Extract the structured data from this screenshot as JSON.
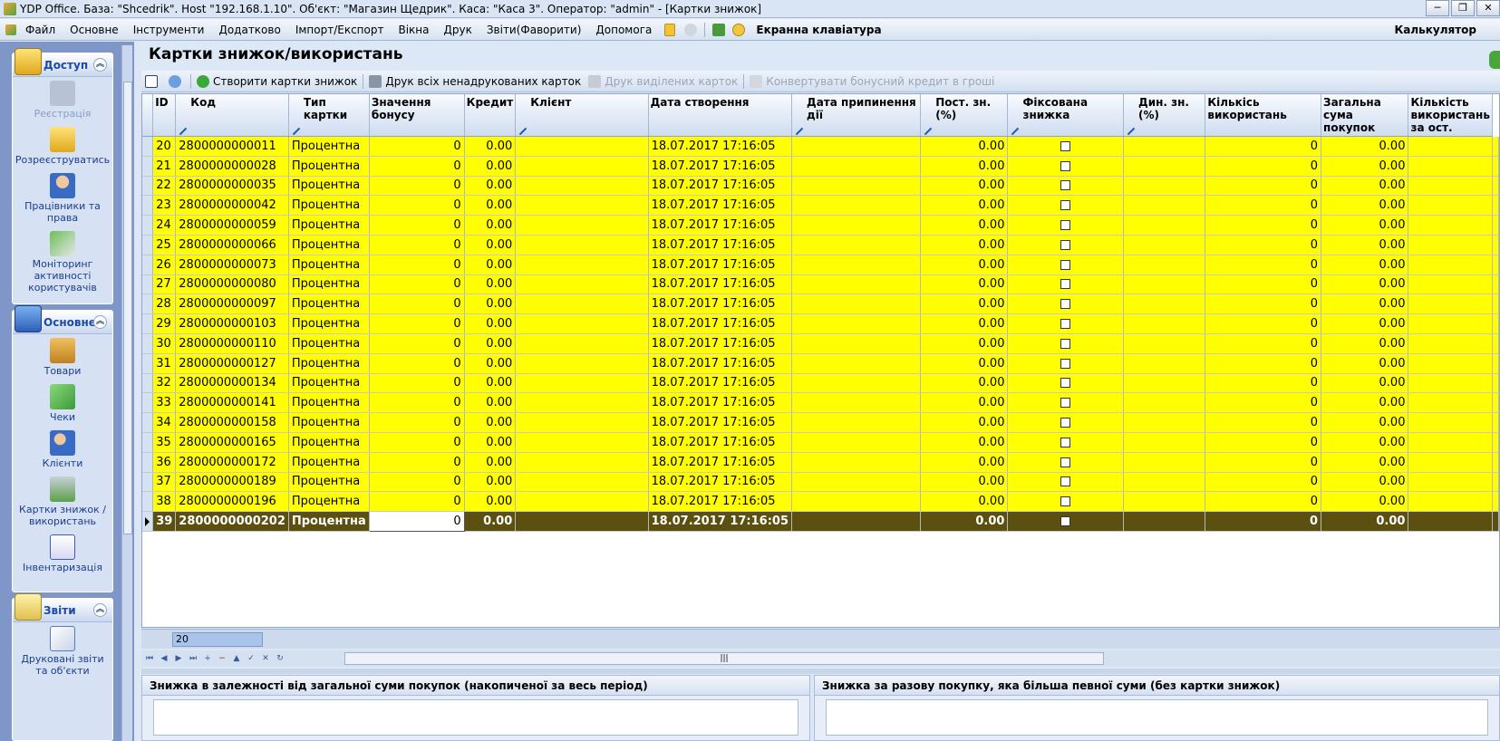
{
  "window": {
    "title": "YDP Office. База: \"Shcedrik\". Host \"192.168.1.10\". Об'єкт: \"Магазин Щедрик\". Каса: \"Каса 3\". Оператор: \"admin\" - [Картки знижок]",
    "buttons": [
      "─",
      "❐",
      "✕"
    ]
  },
  "menu": {
    "items": [
      "Файл",
      "Основне",
      "Інструменти",
      "Додатково",
      "Імпорт/Експорт",
      "Вікна",
      "Друк",
      "Звіти(Фаворити)",
      "Допомога"
    ],
    "onscreen_keyboard": "Екранна клавіатура",
    "calculator": "Калькулятор"
  },
  "sidebar": {
    "groups": [
      {
        "title": "Доступ",
        "items": [
          {
            "label": "Реєстрація",
            "icon": "key-icon",
            "disabled": true
          },
          {
            "label": "Розреєструватись",
            "icon": "lock-icon",
            "disabled": false
          },
          {
            "label": "Працівники та права",
            "icon": "user-icon",
            "disabled": false
          },
          {
            "label": "Моніторинг активності користувачів",
            "icon": "monitoring-icon",
            "disabled": false
          }
        ]
      },
      {
        "title": "Основне",
        "items": [
          {
            "label": "Товари",
            "icon": "boxes-icon",
            "disabled": false
          },
          {
            "label": "Чеки",
            "icon": "receipt-icon",
            "disabled": false
          },
          {
            "label": "Клієнти",
            "icon": "clients-icon",
            "disabled": false
          },
          {
            "label": "Картки знижок / використань",
            "icon": "cart-icon",
            "disabled": false
          },
          {
            "label": "Інвентаризація",
            "icon": "checklist-icon",
            "disabled": false
          }
        ]
      },
      {
        "title": "Звіти",
        "items": [
          {
            "label": "Друковані звіти та об'єкти",
            "icon": "report-icon",
            "disabled": false
          }
        ]
      }
    ]
  },
  "page": {
    "title": "Картки знижок/використань"
  },
  "toolbar": {
    "create": "Створити картки знижок",
    "print_unprinted": "Друк всіх ненадрукованих карток",
    "print_selected": "Друк виділених карток",
    "convert": "Конвертувати бонусний кредит в гроші"
  },
  "grid": {
    "columns": [
      {
        "key": "id",
        "label": "ID",
        "edit": false
      },
      {
        "key": "code",
        "label": "Код",
        "edit": true
      },
      {
        "key": "type",
        "label": "Тип картки",
        "edit": true
      },
      {
        "key": "bonus",
        "label": "Значення бонусу",
        "edit": false
      },
      {
        "key": "credit",
        "label": "Кредит",
        "edit": false
      },
      {
        "key": "client",
        "label": "Клієнт",
        "edit": true
      },
      {
        "key": "created",
        "label": "Дата створення",
        "edit": false
      },
      {
        "key": "ended",
        "label": "Дата припинення дії",
        "edit": true
      },
      {
        "key": "const_disc",
        "label": "Пост. зн.(%)",
        "edit": true
      },
      {
        "key": "fixed",
        "label": "Фіксована знижка",
        "edit": true
      },
      {
        "key": "dyn_disc",
        "label": "Дин. зн.(%)",
        "edit": true
      },
      {
        "key": "uses",
        "label": "Кількісь використань",
        "edit": false
      },
      {
        "key": "total",
        "label": "Загальна сума покупок",
        "edit": false
      },
      {
        "key": "last",
        "label": "Кількість використань за ост.",
        "edit": false
      }
    ],
    "rows": [
      {
        "id": "20",
        "code": "2800000000011",
        "type": "Процентна",
        "bonus": "0",
        "credit": "0.00",
        "client": "",
        "created": "18.07.2017 17:16:05",
        "ended": "",
        "const_disc": "0.00",
        "fixed": false,
        "dyn_disc": "",
        "uses": "0",
        "total": "0.00",
        "last": ""
      },
      {
        "id": "21",
        "code": "2800000000028",
        "type": "Процентна",
        "bonus": "0",
        "credit": "0.00",
        "client": "",
        "created": "18.07.2017 17:16:05",
        "ended": "",
        "const_disc": "0.00",
        "fixed": false,
        "dyn_disc": "",
        "uses": "0",
        "total": "0.00",
        "last": ""
      },
      {
        "id": "22",
        "code": "2800000000035",
        "type": "Процентна",
        "bonus": "0",
        "credit": "0.00",
        "client": "",
        "created": "18.07.2017 17:16:05",
        "ended": "",
        "const_disc": "0.00",
        "fixed": false,
        "dyn_disc": "",
        "uses": "0",
        "total": "0.00",
        "last": ""
      },
      {
        "id": "23",
        "code": "2800000000042",
        "type": "Процентна",
        "bonus": "0",
        "credit": "0.00",
        "client": "",
        "created": "18.07.2017 17:16:05",
        "ended": "",
        "const_disc": "0.00",
        "fixed": false,
        "dyn_disc": "",
        "uses": "0",
        "total": "0.00",
        "last": ""
      },
      {
        "id": "24",
        "code": "2800000000059",
        "type": "Процентна",
        "bonus": "0",
        "credit": "0.00",
        "client": "",
        "created": "18.07.2017 17:16:05",
        "ended": "",
        "const_disc": "0.00",
        "fixed": false,
        "dyn_disc": "",
        "uses": "0",
        "total": "0.00",
        "last": ""
      },
      {
        "id": "25",
        "code": "2800000000066",
        "type": "Процентна",
        "bonus": "0",
        "credit": "0.00",
        "client": "",
        "created": "18.07.2017 17:16:05",
        "ended": "",
        "const_disc": "0.00",
        "fixed": false,
        "dyn_disc": "",
        "uses": "0",
        "total": "0.00",
        "last": ""
      },
      {
        "id": "26",
        "code": "2800000000073",
        "type": "Процентна",
        "bonus": "0",
        "credit": "0.00",
        "client": "",
        "created": "18.07.2017 17:16:05",
        "ended": "",
        "const_disc": "0.00",
        "fixed": false,
        "dyn_disc": "",
        "uses": "0",
        "total": "0.00",
        "last": ""
      },
      {
        "id": "27",
        "code": "2800000000080",
        "type": "Процентна",
        "bonus": "0",
        "credit": "0.00",
        "client": "",
        "created": "18.07.2017 17:16:05",
        "ended": "",
        "const_disc": "0.00",
        "fixed": false,
        "dyn_disc": "",
        "uses": "0",
        "total": "0.00",
        "last": ""
      },
      {
        "id": "28",
        "code": "2800000000097",
        "type": "Процентна",
        "bonus": "0",
        "credit": "0.00",
        "client": "",
        "created": "18.07.2017 17:16:05",
        "ended": "",
        "const_disc": "0.00",
        "fixed": false,
        "dyn_disc": "",
        "uses": "0",
        "total": "0.00",
        "last": ""
      },
      {
        "id": "29",
        "code": "2800000000103",
        "type": "Процентна",
        "bonus": "0",
        "credit": "0.00",
        "client": "",
        "created": "18.07.2017 17:16:05",
        "ended": "",
        "const_disc": "0.00",
        "fixed": false,
        "dyn_disc": "",
        "uses": "0",
        "total": "0.00",
        "last": ""
      },
      {
        "id": "30",
        "code": "2800000000110",
        "type": "Процентна",
        "bonus": "0",
        "credit": "0.00",
        "client": "",
        "created": "18.07.2017 17:16:05",
        "ended": "",
        "const_disc": "0.00",
        "fixed": false,
        "dyn_disc": "",
        "uses": "0",
        "total": "0.00",
        "last": ""
      },
      {
        "id": "31",
        "code": "2800000000127",
        "type": "Процентна",
        "bonus": "0",
        "credit": "0.00",
        "client": "",
        "created": "18.07.2017 17:16:05",
        "ended": "",
        "const_disc": "0.00",
        "fixed": false,
        "dyn_disc": "",
        "uses": "0",
        "total": "0.00",
        "last": ""
      },
      {
        "id": "32",
        "code": "2800000000134",
        "type": "Процентна",
        "bonus": "0",
        "credit": "0.00",
        "client": "",
        "created": "18.07.2017 17:16:05",
        "ended": "",
        "const_disc": "0.00",
        "fixed": false,
        "dyn_disc": "",
        "uses": "0",
        "total": "0.00",
        "last": ""
      },
      {
        "id": "33",
        "code": "2800000000141",
        "type": "Процентна",
        "bonus": "0",
        "credit": "0.00",
        "client": "",
        "created": "18.07.2017 17:16:05",
        "ended": "",
        "const_disc": "0.00",
        "fixed": false,
        "dyn_disc": "",
        "uses": "0",
        "total": "0.00",
        "last": ""
      },
      {
        "id": "34",
        "code": "2800000000158",
        "type": "Процентна",
        "bonus": "0",
        "credit": "0.00",
        "client": "",
        "created": "18.07.2017 17:16:05",
        "ended": "",
        "const_disc": "0.00",
        "fixed": false,
        "dyn_disc": "",
        "uses": "0",
        "total": "0.00",
        "last": ""
      },
      {
        "id": "35",
        "code": "2800000000165",
        "type": "Процентна",
        "bonus": "0",
        "credit": "0.00",
        "client": "",
        "created": "18.07.2017 17:16:05",
        "ended": "",
        "const_disc": "0.00",
        "fixed": false,
        "dyn_disc": "",
        "uses": "0",
        "total": "0.00",
        "last": ""
      },
      {
        "id": "36",
        "code": "2800000000172",
        "type": "Процентна",
        "bonus": "0",
        "credit": "0.00",
        "client": "",
        "created": "18.07.2017 17:16:05",
        "ended": "",
        "const_disc": "0.00",
        "fixed": false,
        "dyn_disc": "",
        "uses": "0",
        "total": "0.00",
        "last": ""
      },
      {
        "id": "37",
        "code": "2800000000189",
        "type": "Процентна",
        "bonus": "0",
        "credit": "0.00",
        "client": "",
        "created": "18.07.2017 17:16:05",
        "ended": "",
        "const_disc": "0.00",
        "fixed": false,
        "dyn_disc": "",
        "uses": "0",
        "total": "0.00",
        "last": ""
      },
      {
        "id": "38",
        "code": "2800000000196",
        "type": "Процентна",
        "bonus": "0",
        "credit": "0.00",
        "client": "",
        "created": "18.07.2017 17:16:05",
        "ended": "",
        "const_disc": "0.00",
        "fixed": false,
        "dyn_disc": "",
        "uses": "0",
        "total": "0.00",
        "last": ""
      },
      {
        "id": "39",
        "code": "2800000000202",
        "type": "Процентна",
        "bonus": "0",
        "credit": "0.00",
        "client": "",
        "created": "18.07.2017 17:16:05",
        "ended": "",
        "const_disc": "0.00",
        "fixed": false,
        "dyn_disc": "",
        "uses": "0",
        "total": "0.00",
        "last": "",
        "selected": true
      }
    ],
    "footer_value": "20"
  },
  "navigator": {
    "buttons": [
      "⏮",
      "◀",
      "▶",
      "⏭",
      "+",
      "−",
      "▲",
      "✓",
      "✕",
      "↻"
    ]
  },
  "bottom": {
    "left_title": "Знижка в залежності від загальної суми покупок (накопиченої за весь період)",
    "right_title": "Знижка за разову покупку, яка більша певної суми (без картки знижок)"
  },
  "colors": {
    "row_bg": "#ffff00",
    "selected_row_bg": "#5b5010",
    "sidebar_bg": "#7f96c9"
  }
}
